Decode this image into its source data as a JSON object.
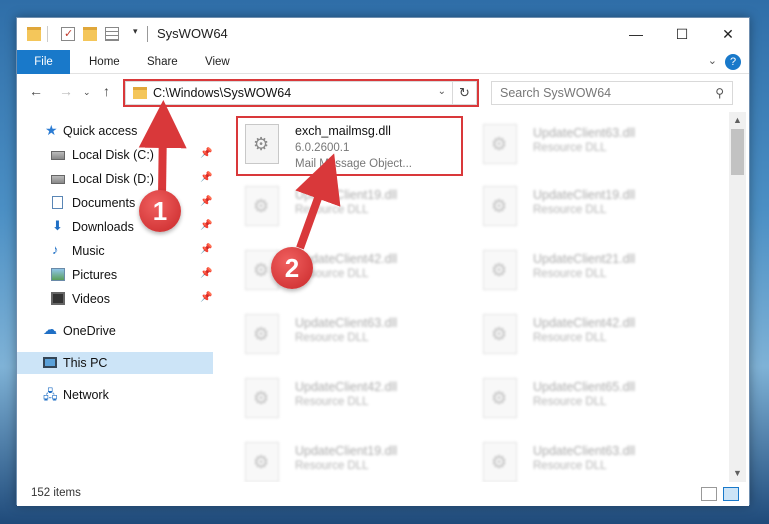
{
  "window": {
    "title": "SysWOW64",
    "controls": {
      "minimize": "—",
      "maximize": "☐",
      "close": "✕"
    }
  },
  "ribbon": {
    "tabs": [
      "File",
      "Home",
      "Share",
      "View"
    ],
    "accent": "#1979ca"
  },
  "navigation": {
    "address": "C:\\Windows\\SysWOW64",
    "search_placeholder": "Search SysWOW64"
  },
  "sidebar": {
    "items": [
      {
        "label": "Quick access",
        "icon": "star-icon",
        "pinned": false
      },
      {
        "label": "Local Disk (C:)",
        "icon": "disk-icon",
        "pinned": true
      },
      {
        "label": "Local Disk (D:)",
        "icon": "disk-icon",
        "pinned": true
      },
      {
        "label": "Documents",
        "icon": "document-icon",
        "pinned": true
      },
      {
        "label": "Downloads",
        "icon": "download-icon",
        "pinned": true
      },
      {
        "label": "Music",
        "icon": "music-icon",
        "pinned": true
      },
      {
        "label": "Pictures",
        "icon": "pictures-icon",
        "pinned": true
      },
      {
        "label": "Videos",
        "icon": "videos-icon",
        "pinned": true
      },
      {
        "label": "OneDrive",
        "icon": "cloud-icon",
        "pinned": false
      },
      {
        "label": "This PC",
        "icon": "computer-icon",
        "pinned": false,
        "selected": true
      },
      {
        "label": "Network",
        "icon": "network-icon",
        "pinned": false
      }
    ]
  },
  "files": {
    "left": [
      {
        "name": "exch_mailmsg.dll",
        "version": "6.0.2600.1",
        "description": "Mail Message Object..."
      },
      {
        "name": "UpdateClient19.dll",
        "description": "Resource DLL"
      },
      {
        "name": "UpdateClient42.dll",
        "description": "Resource DLL"
      },
      {
        "name": "UpdateClient63.dll",
        "description": "Resource DLL"
      },
      {
        "name": "UpdateClient42.dll",
        "description": "Resource DLL"
      },
      {
        "name": "UpdateClient19.dll",
        "description": "Resource DLL"
      }
    ],
    "right": [
      {
        "name": "UpdateClient63.dll",
        "description": "Resource DLL"
      },
      {
        "name": "UpdateClient19.dll",
        "description": "Resource DLL"
      },
      {
        "name": "UpdateClient21.dll",
        "description": "Resource DLL"
      },
      {
        "name": "UpdateClient42.dll",
        "description": "Resource DLL"
      },
      {
        "name": "UpdateClient65.dll",
        "description": "Resource DLL"
      },
      {
        "name": "UpdateClient63.dll",
        "description": "Resource DLL"
      }
    ]
  },
  "status": {
    "item_count": "152 items"
  },
  "annotations": {
    "badge_1": "1",
    "badge_2": "2",
    "color": "#d9383a"
  }
}
